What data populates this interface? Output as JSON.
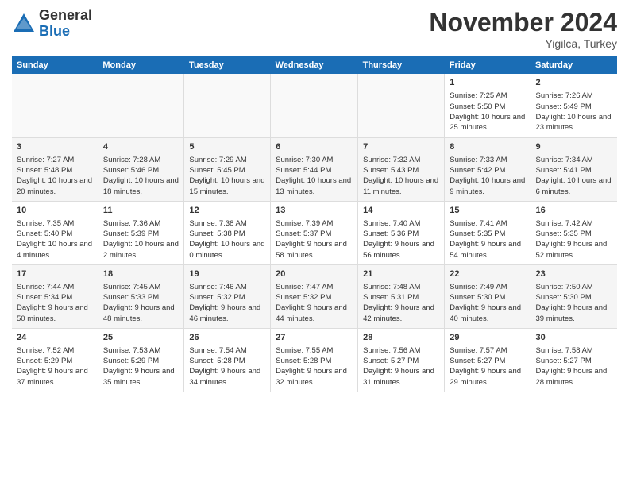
{
  "header": {
    "logo_general": "General",
    "logo_blue": "Blue",
    "month_title": "November 2024",
    "location": "Yigilca, Turkey"
  },
  "days_of_week": [
    "Sunday",
    "Monday",
    "Tuesday",
    "Wednesday",
    "Thursday",
    "Friday",
    "Saturday"
  ],
  "weeks": [
    [
      {
        "day": "",
        "info": ""
      },
      {
        "day": "",
        "info": ""
      },
      {
        "day": "",
        "info": ""
      },
      {
        "day": "",
        "info": ""
      },
      {
        "day": "",
        "info": ""
      },
      {
        "day": "1",
        "info": "Sunrise: 7:25 AM\nSunset: 5:50 PM\nDaylight: 10 hours and 25 minutes."
      },
      {
        "day": "2",
        "info": "Sunrise: 7:26 AM\nSunset: 5:49 PM\nDaylight: 10 hours and 23 minutes."
      }
    ],
    [
      {
        "day": "3",
        "info": "Sunrise: 7:27 AM\nSunset: 5:48 PM\nDaylight: 10 hours and 20 minutes."
      },
      {
        "day": "4",
        "info": "Sunrise: 7:28 AM\nSunset: 5:46 PM\nDaylight: 10 hours and 18 minutes."
      },
      {
        "day": "5",
        "info": "Sunrise: 7:29 AM\nSunset: 5:45 PM\nDaylight: 10 hours and 15 minutes."
      },
      {
        "day": "6",
        "info": "Sunrise: 7:30 AM\nSunset: 5:44 PM\nDaylight: 10 hours and 13 minutes."
      },
      {
        "day": "7",
        "info": "Sunrise: 7:32 AM\nSunset: 5:43 PM\nDaylight: 10 hours and 11 minutes."
      },
      {
        "day": "8",
        "info": "Sunrise: 7:33 AM\nSunset: 5:42 PM\nDaylight: 10 hours and 9 minutes."
      },
      {
        "day": "9",
        "info": "Sunrise: 7:34 AM\nSunset: 5:41 PM\nDaylight: 10 hours and 6 minutes."
      }
    ],
    [
      {
        "day": "10",
        "info": "Sunrise: 7:35 AM\nSunset: 5:40 PM\nDaylight: 10 hours and 4 minutes."
      },
      {
        "day": "11",
        "info": "Sunrise: 7:36 AM\nSunset: 5:39 PM\nDaylight: 10 hours and 2 minutes."
      },
      {
        "day": "12",
        "info": "Sunrise: 7:38 AM\nSunset: 5:38 PM\nDaylight: 10 hours and 0 minutes."
      },
      {
        "day": "13",
        "info": "Sunrise: 7:39 AM\nSunset: 5:37 PM\nDaylight: 9 hours and 58 minutes."
      },
      {
        "day": "14",
        "info": "Sunrise: 7:40 AM\nSunset: 5:36 PM\nDaylight: 9 hours and 56 minutes."
      },
      {
        "day": "15",
        "info": "Sunrise: 7:41 AM\nSunset: 5:35 PM\nDaylight: 9 hours and 54 minutes."
      },
      {
        "day": "16",
        "info": "Sunrise: 7:42 AM\nSunset: 5:35 PM\nDaylight: 9 hours and 52 minutes."
      }
    ],
    [
      {
        "day": "17",
        "info": "Sunrise: 7:44 AM\nSunset: 5:34 PM\nDaylight: 9 hours and 50 minutes."
      },
      {
        "day": "18",
        "info": "Sunrise: 7:45 AM\nSunset: 5:33 PM\nDaylight: 9 hours and 48 minutes."
      },
      {
        "day": "19",
        "info": "Sunrise: 7:46 AM\nSunset: 5:32 PM\nDaylight: 9 hours and 46 minutes."
      },
      {
        "day": "20",
        "info": "Sunrise: 7:47 AM\nSunset: 5:32 PM\nDaylight: 9 hours and 44 minutes."
      },
      {
        "day": "21",
        "info": "Sunrise: 7:48 AM\nSunset: 5:31 PM\nDaylight: 9 hours and 42 minutes."
      },
      {
        "day": "22",
        "info": "Sunrise: 7:49 AM\nSunset: 5:30 PM\nDaylight: 9 hours and 40 minutes."
      },
      {
        "day": "23",
        "info": "Sunrise: 7:50 AM\nSunset: 5:30 PM\nDaylight: 9 hours and 39 minutes."
      }
    ],
    [
      {
        "day": "24",
        "info": "Sunrise: 7:52 AM\nSunset: 5:29 PM\nDaylight: 9 hours and 37 minutes."
      },
      {
        "day": "25",
        "info": "Sunrise: 7:53 AM\nSunset: 5:29 PM\nDaylight: 9 hours and 35 minutes."
      },
      {
        "day": "26",
        "info": "Sunrise: 7:54 AM\nSunset: 5:28 PM\nDaylight: 9 hours and 34 minutes."
      },
      {
        "day": "27",
        "info": "Sunrise: 7:55 AM\nSunset: 5:28 PM\nDaylight: 9 hours and 32 minutes."
      },
      {
        "day": "28",
        "info": "Sunrise: 7:56 AM\nSunset: 5:27 PM\nDaylight: 9 hours and 31 minutes."
      },
      {
        "day": "29",
        "info": "Sunrise: 7:57 AM\nSunset: 5:27 PM\nDaylight: 9 hours and 29 minutes."
      },
      {
        "day": "30",
        "info": "Sunrise: 7:58 AM\nSunset: 5:27 PM\nDaylight: 9 hours and 28 minutes."
      }
    ]
  ]
}
